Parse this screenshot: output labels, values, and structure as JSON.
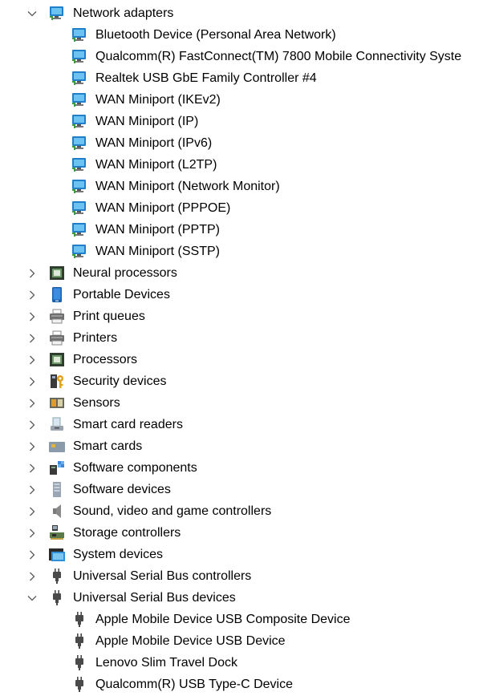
{
  "tree": [
    {
      "label": "Network adapters",
      "icon": "network-adapter-icon",
      "level": 0,
      "state": "expanded"
    },
    {
      "label": "Bluetooth Device (Personal Area Network)",
      "icon": "network-adapter-icon",
      "level": 1
    },
    {
      "label": "Qualcomm(R) FastConnect(TM) 7800 Mobile Connectivity Syste",
      "icon": "network-adapter-icon",
      "level": 1
    },
    {
      "label": "Realtek USB GbE Family Controller #4",
      "icon": "network-adapter-icon",
      "level": 1
    },
    {
      "label": "WAN Miniport (IKEv2)",
      "icon": "network-adapter-icon",
      "level": 1
    },
    {
      "label": "WAN Miniport (IP)",
      "icon": "network-adapter-icon",
      "level": 1
    },
    {
      "label": "WAN Miniport (IPv6)",
      "icon": "network-adapter-icon",
      "level": 1
    },
    {
      "label": "WAN Miniport (L2TP)",
      "icon": "network-adapter-icon",
      "level": 1
    },
    {
      "label": "WAN Miniport (Network Monitor)",
      "icon": "network-adapter-icon",
      "level": 1
    },
    {
      "label": "WAN Miniport (PPPOE)",
      "icon": "network-adapter-icon",
      "level": 1
    },
    {
      "label": "WAN Miniport (PPTP)",
      "icon": "network-adapter-icon",
      "level": 1
    },
    {
      "label": "WAN Miniport (SSTP)",
      "icon": "network-adapter-icon",
      "level": 1
    },
    {
      "label": "Neural processors",
      "icon": "chip-icon",
      "level": 0,
      "state": "collapsed"
    },
    {
      "label": "Portable Devices",
      "icon": "portable-device-icon",
      "level": 0,
      "state": "collapsed"
    },
    {
      "label": "Print queues",
      "icon": "printer-icon",
      "level": 0,
      "state": "collapsed"
    },
    {
      "label": "Printers",
      "icon": "printer-icon",
      "level": 0,
      "state": "collapsed"
    },
    {
      "label": "Processors",
      "icon": "chip-icon",
      "level": 0,
      "state": "collapsed"
    },
    {
      "label": "Security devices",
      "icon": "security-key-icon",
      "level": 0,
      "state": "collapsed"
    },
    {
      "label": "Sensors",
      "icon": "sensor-icon",
      "level": 0,
      "state": "collapsed"
    },
    {
      "label": "Smart card readers",
      "icon": "smart-card-reader-icon",
      "level": 0,
      "state": "collapsed"
    },
    {
      "label": "Smart cards",
      "icon": "smart-card-icon",
      "level": 0,
      "state": "collapsed"
    },
    {
      "label": "Software components",
      "icon": "software-component-icon",
      "level": 0,
      "state": "collapsed"
    },
    {
      "label": "Software devices",
      "icon": "software-device-icon",
      "level": 0,
      "state": "collapsed"
    },
    {
      "label": "Sound, video and game controllers",
      "icon": "speaker-icon",
      "level": 0,
      "state": "collapsed"
    },
    {
      "label": "Storage controllers",
      "icon": "storage-controller-icon",
      "level": 0,
      "state": "collapsed"
    },
    {
      "label": "System devices",
      "icon": "system-folder-icon",
      "level": 0,
      "state": "collapsed"
    },
    {
      "label": "Universal Serial Bus controllers",
      "icon": "usb-plug-icon",
      "level": 0,
      "state": "collapsed"
    },
    {
      "label": "Universal Serial Bus devices",
      "icon": "usb-plug-icon",
      "level": 0,
      "state": "expanded"
    },
    {
      "label": "Apple Mobile Device USB Composite Device",
      "icon": "usb-plug-icon",
      "level": 1
    },
    {
      "label": "Apple Mobile Device USB Device",
      "icon": "usb-plug-icon",
      "level": 1
    },
    {
      "label": "Lenovo Slim Travel Dock",
      "icon": "usb-plug-icon",
      "level": 1
    },
    {
      "label": "Qualcomm(R) USB Type-C Device",
      "icon": "usb-plug-icon",
      "level": 1
    }
  ],
  "colors": {
    "chevron": "#5a5a5a",
    "monitor_frame": "#1f7fc9",
    "monitor_screen": "#6cc3f2",
    "network_cable": "#3e9a3e",
    "chip_body": "#2f3d2f",
    "chip_core": "#6f9a6a",
    "usb_plug": "#4a4a4a",
    "printer": "#6f6f6f",
    "key": "#e0a020"
  }
}
